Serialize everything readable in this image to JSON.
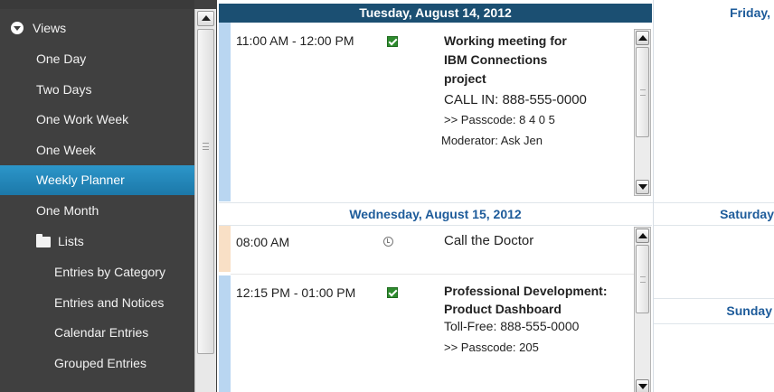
{
  "sidebar": {
    "views_label": "Views",
    "items": [
      {
        "label": "One Day"
      },
      {
        "label": "Two Days"
      },
      {
        "label": "One Work Week"
      },
      {
        "label": "One Week"
      },
      {
        "label": "Weekly Planner",
        "selected": true
      },
      {
        "label": "One Month"
      }
    ],
    "lists_label": "Lists",
    "list_items": [
      {
        "label": "Entries by Category"
      },
      {
        "label": "Entries and Notices"
      },
      {
        "label": "Calendar Entries"
      },
      {
        "label": "Grouped Entries"
      }
    ]
  },
  "days": {
    "tuesday": {
      "header": "Tuesday, August 14, 2012",
      "events": [
        {
          "time": "11:00 AM  -  12:00 PM",
          "icon": "check-icon",
          "title_lines": [
            "Working meeting for",
            "IBM Connections",
            "project"
          ],
          "details": [
            "CALL IN: 888-555-0000",
            ">> Passcode: 8 4 0 5",
            "Moderator: Ask Jen"
          ]
        }
      ]
    },
    "wednesday": {
      "header": "Wednesday, August 15, 2012",
      "events": [
        {
          "time": "08:00 AM",
          "icon": "clock-icon",
          "title_lines": [
            "Call the Doctor"
          ],
          "details": []
        },
        {
          "time": "12:15 PM  -  01:00 PM",
          "icon": "check-icon",
          "title_lines": [
            "Professional Development:",
            "Product Dashboard"
          ],
          "details": [
            "Toll-Free: 888-555-0000",
            ">> Passcode: 205"
          ]
        }
      ]
    },
    "friday": {
      "header": "Friday,"
    },
    "saturday": {
      "header": "Saturday"
    },
    "sunday": {
      "header": "Sunday"
    }
  },
  "colors": {
    "sidebar_bg": "#404040",
    "selected_bg": "#1c78a9",
    "active_day_header": "#1b4f72",
    "day_header_text": "#1d5b9a",
    "confirmed_icon": "#2e8b2e",
    "event_stripe_blue": "#b9d6f1",
    "event_stripe_peach": "#f9e0c6"
  }
}
